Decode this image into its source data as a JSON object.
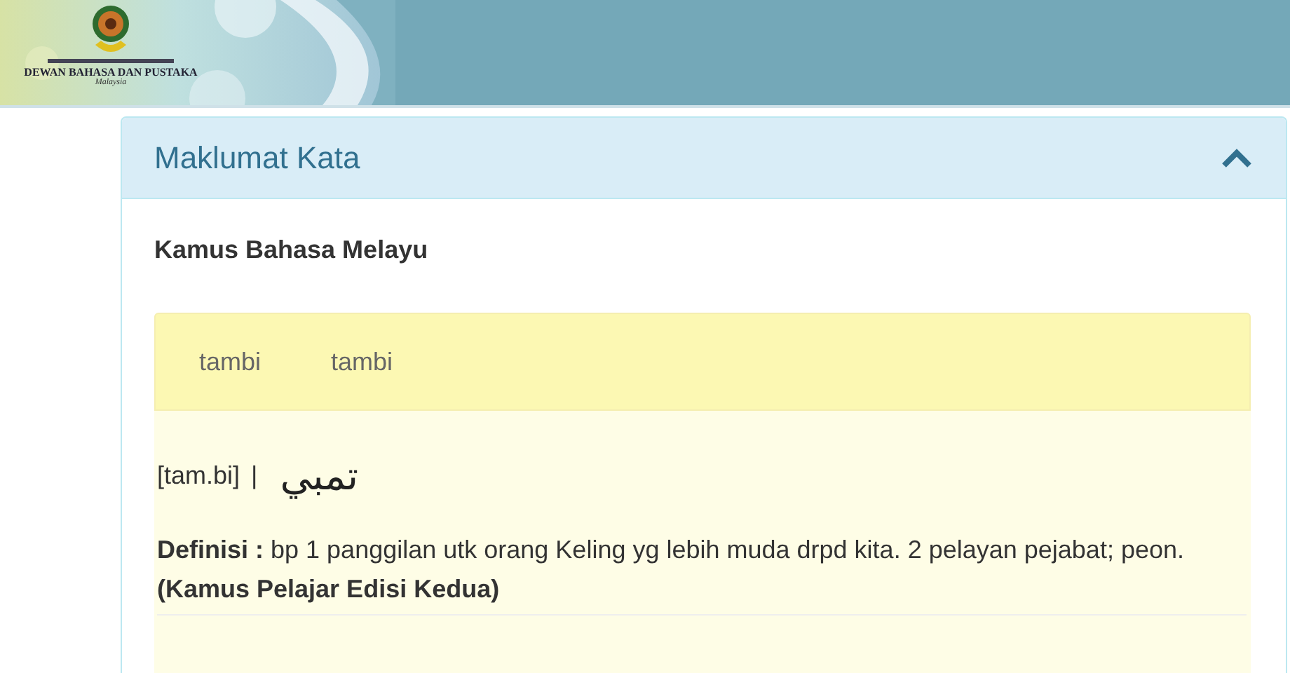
{
  "header": {
    "logo_name": "DEWAN BAHASA DAN PUSTAKA",
    "logo_country": "Malaysia"
  },
  "panel": {
    "title": "Maklumat Kata",
    "expanded": true,
    "dictionary": "Kamus Bahasa Melayu",
    "entry_tabs": [
      {
        "label": "tambi"
      },
      {
        "label": "tambi"
      }
    ],
    "pronunciation": "[tam.bi]",
    "separator": "|",
    "jawi": "تمبي",
    "definition": "**Definisi :** bp 1 panggilan utk orang Keling yg lebih muda drpd kita. 2 pelayan pejabat; peon. **(Kamus Pelajar Edisi Kedua)**"
  }
}
